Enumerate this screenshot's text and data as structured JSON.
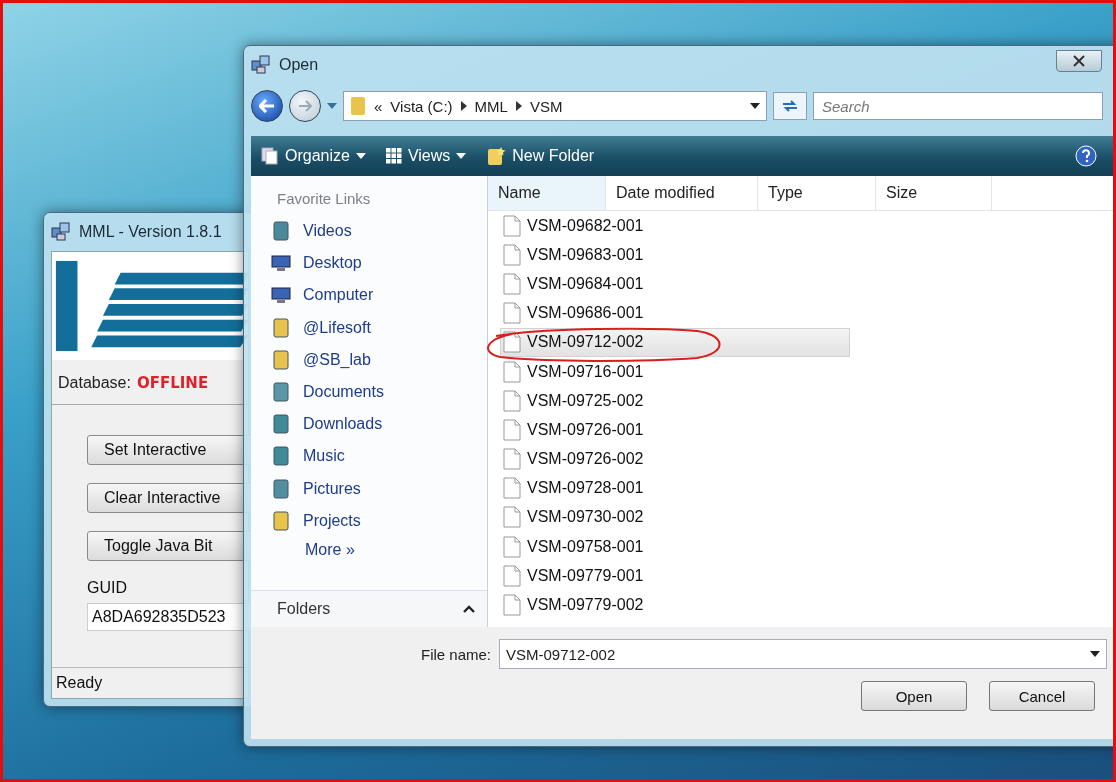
{
  "background_window": {
    "title": "MML - Version 1.8.1",
    "database_label": "Database:",
    "database_status": "OFFLINE",
    "buttons": [
      "Set Interactive",
      "Clear Interactive",
      "Toggle Java Bit"
    ],
    "guid_label": "GUID",
    "guid_value": "A8DA692835D523",
    "status_bar": "Ready"
  },
  "dialog": {
    "title": "Open",
    "breadcrumb": [
      "«",
      "Vista (C:)",
      "MML",
      "VSM"
    ],
    "search": {
      "placeholder": "Search"
    },
    "toolbar": [
      {
        "kind": "menu",
        "label": "Organize"
      },
      {
        "kind": "menu",
        "label": "Views"
      },
      {
        "kind": "plain",
        "label": "New Folder"
      }
    ],
    "favorite_links_title": "Favorite Links",
    "favorite_links": [
      {
        "label": "Videos",
        "kind": "videos"
      },
      {
        "label": "Desktop",
        "kind": "desktop"
      },
      {
        "label": "Computer",
        "kind": "computer"
      },
      {
        "label": "@Lifesoft",
        "kind": "folder"
      },
      {
        "label": "@SB_lab",
        "kind": "folder"
      },
      {
        "label": "Documents",
        "kind": "documents"
      },
      {
        "label": "Downloads",
        "kind": "downloads"
      },
      {
        "label": "Music",
        "kind": "music"
      },
      {
        "label": "Pictures",
        "kind": "pictures"
      },
      {
        "label": "Projects",
        "kind": "folder"
      }
    ],
    "more_link": "More »",
    "folders_label": "Folders",
    "columns": [
      "Name",
      "Date modified",
      "Type",
      "Size"
    ],
    "files": [
      {
        "name": "VSM-09682-001",
        "selected": false
      },
      {
        "name": "VSM-09683-001",
        "selected": false
      },
      {
        "name": "VSM-09684-001",
        "selected": false
      },
      {
        "name": "VSM-09686-001",
        "selected": false
      },
      {
        "name": "VSM-09712-002",
        "selected": true
      },
      {
        "name": "VSM-09716-001",
        "selected": false
      },
      {
        "name": "VSM-09725-002",
        "selected": false
      },
      {
        "name": "VSM-09726-001",
        "selected": false
      },
      {
        "name": "VSM-09726-002",
        "selected": false
      },
      {
        "name": "VSM-09728-001",
        "selected": false
      },
      {
        "name": "VSM-09730-002",
        "selected": false
      },
      {
        "name": "VSM-09758-001",
        "selected": false
      },
      {
        "name": "VSM-09779-001",
        "selected": false
      },
      {
        "name": "VSM-09779-002",
        "selected": false
      }
    ],
    "file_name_label": "File name:",
    "file_name_value": "VSM-09712-002",
    "buttons": [
      "Open",
      "Cancel"
    ]
  }
}
